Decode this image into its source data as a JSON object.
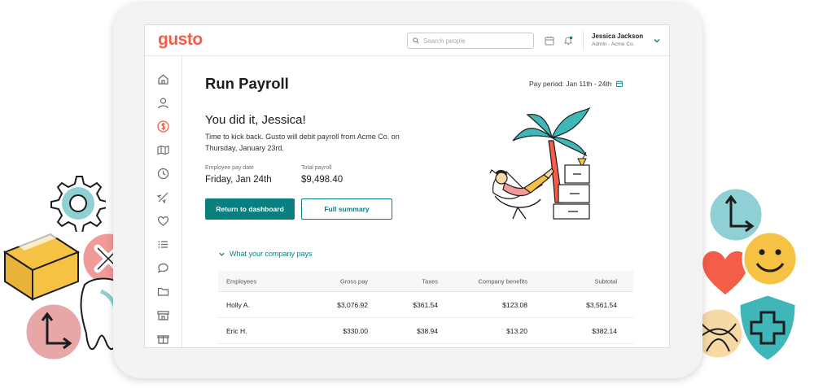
{
  "app": {
    "logo_text": "gusto",
    "brand_color": "#f45d48",
    "accent_color": "#0a7f80"
  },
  "topbar": {
    "search_placeholder": "Search people",
    "icons": [
      "search-icon",
      "calendar-icon",
      "bell-icon",
      "chevron-down-icon"
    ],
    "user_name": "Jessica Jackson",
    "user_subtitle": "Admin - Acme Co."
  },
  "sidebar": {
    "items": [
      {
        "name": "home",
        "icon": "home-icon"
      },
      {
        "name": "people",
        "icon": "person-icon"
      },
      {
        "name": "payroll",
        "icon": "dollar-icon",
        "active": true
      },
      {
        "name": "reports",
        "icon": "map-icon"
      },
      {
        "name": "time-tools",
        "icon": "clock-icon"
      },
      {
        "name": "travel",
        "icon": "airplane-icon"
      },
      {
        "name": "benefits",
        "icon": "heart-icon"
      },
      {
        "name": "list",
        "icon": "list-icon"
      },
      {
        "name": "chat",
        "icon": "chat-icon"
      },
      {
        "name": "documents",
        "icon": "folder-icon"
      },
      {
        "name": "company",
        "icon": "store-icon"
      },
      {
        "name": "perks",
        "icon": "gift-icon"
      }
    ]
  },
  "main": {
    "title": "Run Payroll",
    "pay_period": "Pay period: Jan 11th - 24th",
    "congrats": "You did it, Jessica!",
    "message": "Time to kick back. Gusto will debit payroll from Acme Co. on Thursday, January 23rd.",
    "employee_pay_date_label": "Employee pay date",
    "employee_pay_date": "Friday, Jan 24th",
    "total_payroll_label": "Total payroll",
    "total_payroll": "$9,498.40",
    "primary_button": "Return to dashboard",
    "secondary_button": "Full summary"
  },
  "company_pays": {
    "toggle_label": "What your company pays",
    "columns": [
      "Employees",
      "Gross pay",
      "Taxes",
      "Company benefits",
      "Subtotal"
    ],
    "rows": [
      [
        "Holly A.",
        "$3,076.92",
        "$361.54",
        "$123.08",
        "$3,561.54"
      ],
      [
        "Eric H.",
        "$330.00",
        "$38.94",
        "$13.20",
        "$382.14"
      ]
    ]
  }
}
